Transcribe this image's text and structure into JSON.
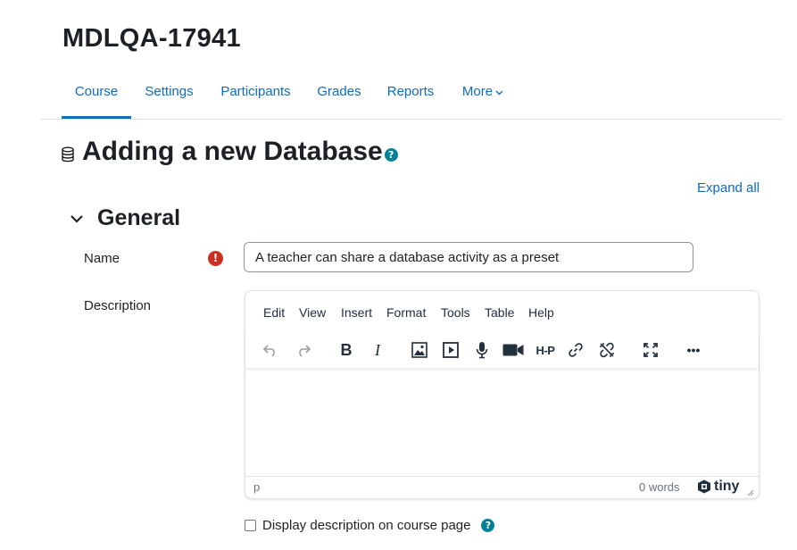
{
  "course": {
    "title": "MDLQA-17941"
  },
  "nav": {
    "tabs": [
      {
        "label": "Course",
        "active": true
      },
      {
        "label": "Settings"
      },
      {
        "label": "Participants"
      },
      {
        "label": "Grades"
      },
      {
        "label": "Reports"
      },
      {
        "label": "More"
      }
    ]
  },
  "page": {
    "heading": "Adding a new Database",
    "help": "?"
  },
  "form": {
    "expand_all": "Expand all",
    "section_title": "General",
    "name_label": "Name",
    "name_required": "!",
    "name_value": "A teacher can share a database activity as a preset",
    "description_label": "Description",
    "display_description_label": "Display description on course page",
    "display_description_checked": false
  },
  "editor": {
    "menu": [
      "Edit",
      "View",
      "Insert",
      "Format",
      "Tools",
      "Table",
      "Help"
    ],
    "toolbar_icons": [
      "undo-icon",
      "redo-icon",
      "bold-icon",
      "italic-icon",
      "image-icon",
      "media-icon",
      "microphone-icon",
      "video-camera-icon",
      "h5p-icon",
      "link-icon",
      "unlink-icon",
      "fullscreen-icon",
      "more-icon"
    ],
    "bold_label": "B",
    "italic_label": "I",
    "h5p_label": "H-P",
    "more_label": "•••",
    "status_path": "p",
    "word_count": "0 words",
    "brand": "tiny"
  },
  "colors": {
    "link": "#0f6cbf",
    "help": "#008196",
    "required": "#ca3120",
    "text": "#1d2125"
  }
}
